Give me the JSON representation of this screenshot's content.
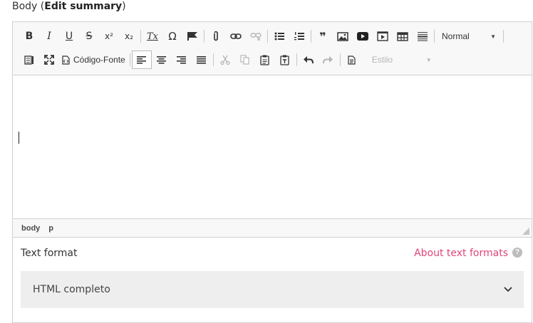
{
  "field": {
    "label": "Body",
    "paren_open": "(",
    "link": "Edit summary",
    "paren_close": ")"
  },
  "toolbar": {
    "bold": "B",
    "italic": "I",
    "underline": "U",
    "strike": "S",
    "superscript": "x²",
    "subscript": "x₂",
    "remove_format": "Tx",
    "special_char": "Ω",
    "quote": "❞",
    "format_value": "Normal",
    "source_label": "Código-Fonte",
    "style_value": "Estilo"
  },
  "statusbar": {
    "path": [
      "body",
      "p"
    ]
  },
  "text_format": {
    "label": "Text format",
    "link": "About text formats",
    "help": "?",
    "selected": "HTML completo"
  }
}
